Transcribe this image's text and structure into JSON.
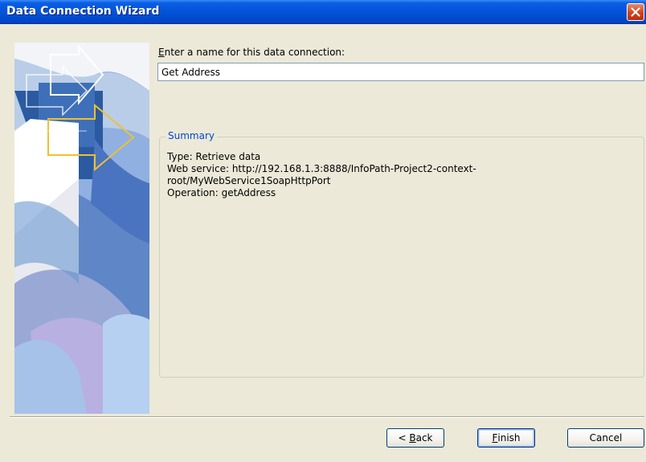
{
  "window": {
    "title": "Data Connection Wizard"
  },
  "form": {
    "name_label_mnemonic": "E",
    "name_label_rest": "nter a name for this data connection:",
    "name_value": "Get Address"
  },
  "summary": {
    "legend": "Summary",
    "lines": [
      "Type: Retrieve data",
      "Web service: http://192.168.1.3:8888/InfoPath-Project2-context-",
      "root/MyWebService1SoapHttpPort",
      "Operation: getAddress"
    ]
  },
  "buttons": {
    "back_prefix": "< ",
    "back_mnemonic": "B",
    "back_rest": "ack",
    "finish_mnemonic": "F",
    "finish_rest": "inish",
    "cancel": "Cancel"
  },
  "icons": {
    "close": "close-icon",
    "banner": "wizard-banner-graphic"
  },
  "colors": {
    "titlebar": "#0453d8",
    "summary_legend": "#0046d5",
    "close_button": "#d2431a"
  }
}
